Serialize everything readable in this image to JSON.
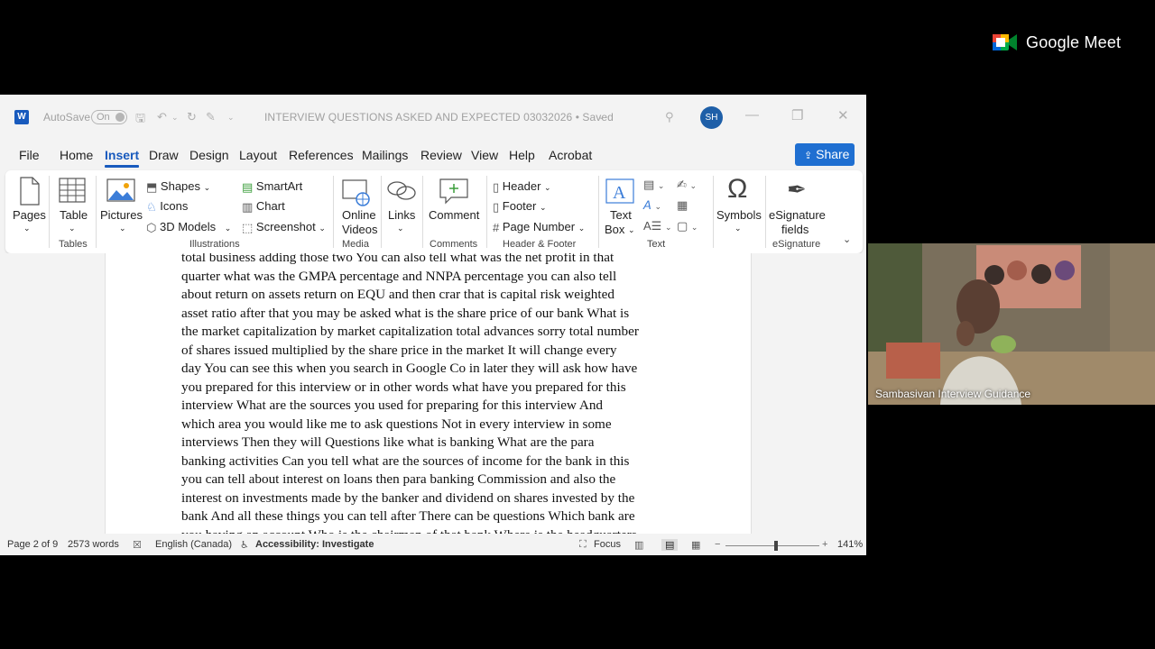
{
  "titlebar": {
    "autosave_label": "AutoSave",
    "autosave_state": "On",
    "doc_title": "INTERVIEW QUESTIONS ASKED AND EXPECTED 03032026 • Saved",
    "user_initials": "SH"
  },
  "menu": {
    "items": [
      "File",
      "Home",
      "Insert",
      "Draw",
      "Design",
      "Layout",
      "References",
      "Mailings",
      "Review",
      "View",
      "Help",
      "Acrobat"
    ],
    "active": "Insert",
    "share_label": "Share"
  },
  "ribbon": {
    "pages": "Pages",
    "table": "Table",
    "tables_group": "Tables",
    "pictures": "Pictures",
    "shapes": "Shapes",
    "icons": "Icons",
    "models": "3D Models",
    "smartart": "SmartArt",
    "chart": "Chart",
    "screenshot": "Screenshot",
    "illustrations_group": "Illustrations",
    "online_videos_1": "Online",
    "online_videos_2": "Videos",
    "media_group": "Media",
    "links": "Links",
    "comment": "Comment",
    "comments_group": "Comments",
    "header": "Header",
    "footer": "Footer",
    "page_number": "Page Number",
    "header_footer_group": "Header & Footer",
    "text_box_1": "Text",
    "text_box_2": "Box",
    "text_group": "Text",
    "symbols": "Symbols",
    "esig_1": "eSignature",
    "esig_2": "fields",
    "esig_group": "eSignature"
  },
  "document": {
    "lines": [
      "total business adding those two You can also tell what was the net profit in that",
      "quarter what was the GMPA percentage and NNPA percentage you can also tell",
      "about return on assets return on EQU and then crar that is capital risk weighted",
      "asset ratio after that you may be asked what is the share price of our bank What is",
      "the market capitalization by market capitalization total advances sorry total number",
      "of shares issued multiplied by the share price in the market It will change every",
      "day You can see this when you search in Google Co in later they will ask how have",
      "you prepared for this interview or in other words what have you prepared for this",
      "interview What are the sources you used for preparing for this interview And",
      "which area you would like me to ask questions Not in every interview in some",
      "interviews Then they will Questions like what is banking What are the para",
      "banking activities Can you tell what are the sources of income for the bank in this",
      "you can tell about interest on loans then para banking Commission and also the",
      "interest on investments made by the banker and dividend on shares invested by the",
      "bank And all these things you can tell after There can be questions Which bank are",
      "you having an account Who is the chairman of that bank Where is the headquarters"
    ]
  },
  "status": {
    "page": "Page 2 of 9",
    "words": "2573 words",
    "language": "English (Canada)",
    "accessibility": "Accessibility: Investigate",
    "focus": "Focus",
    "zoom": "141%"
  },
  "meet": {
    "brand": "Google Meet",
    "participant": "Sambasivan Interview Guidance"
  },
  "colors": {
    "word_blue": "#185abd",
    "share_blue": "#1f6fd1",
    "avatar": "#1e5fa8"
  }
}
